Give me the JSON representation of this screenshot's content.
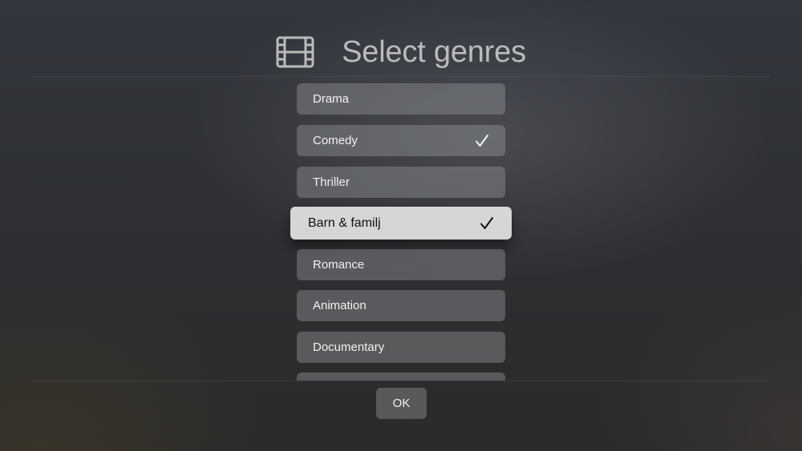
{
  "header": {
    "icon": "film-strip-icon",
    "title": "Select genres"
  },
  "genres": [
    {
      "label": "Drama",
      "selected": false,
      "focused": false
    },
    {
      "label": "Comedy",
      "selected": true,
      "focused": false
    },
    {
      "label": "Thriller",
      "selected": false,
      "focused": false
    },
    {
      "label": "Barn & familj",
      "selected": true,
      "focused": true
    },
    {
      "label": "Romance",
      "selected": false,
      "focused": false
    },
    {
      "label": "Animation",
      "selected": false,
      "focused": false
    },
    {
      "label": "Documentary",
      "selected": false,
      "focused": false
    },
    {
      "label": "",
      "selected": false,
      "focused": false
    }
  ],
  "footer": {
    "ok_label": "OK"
  },
  "colors": {
    "title": "#b9bbbe",
    "item_background": "#75777d",
    "focused_background": "#d6d6d6"
  }
}
